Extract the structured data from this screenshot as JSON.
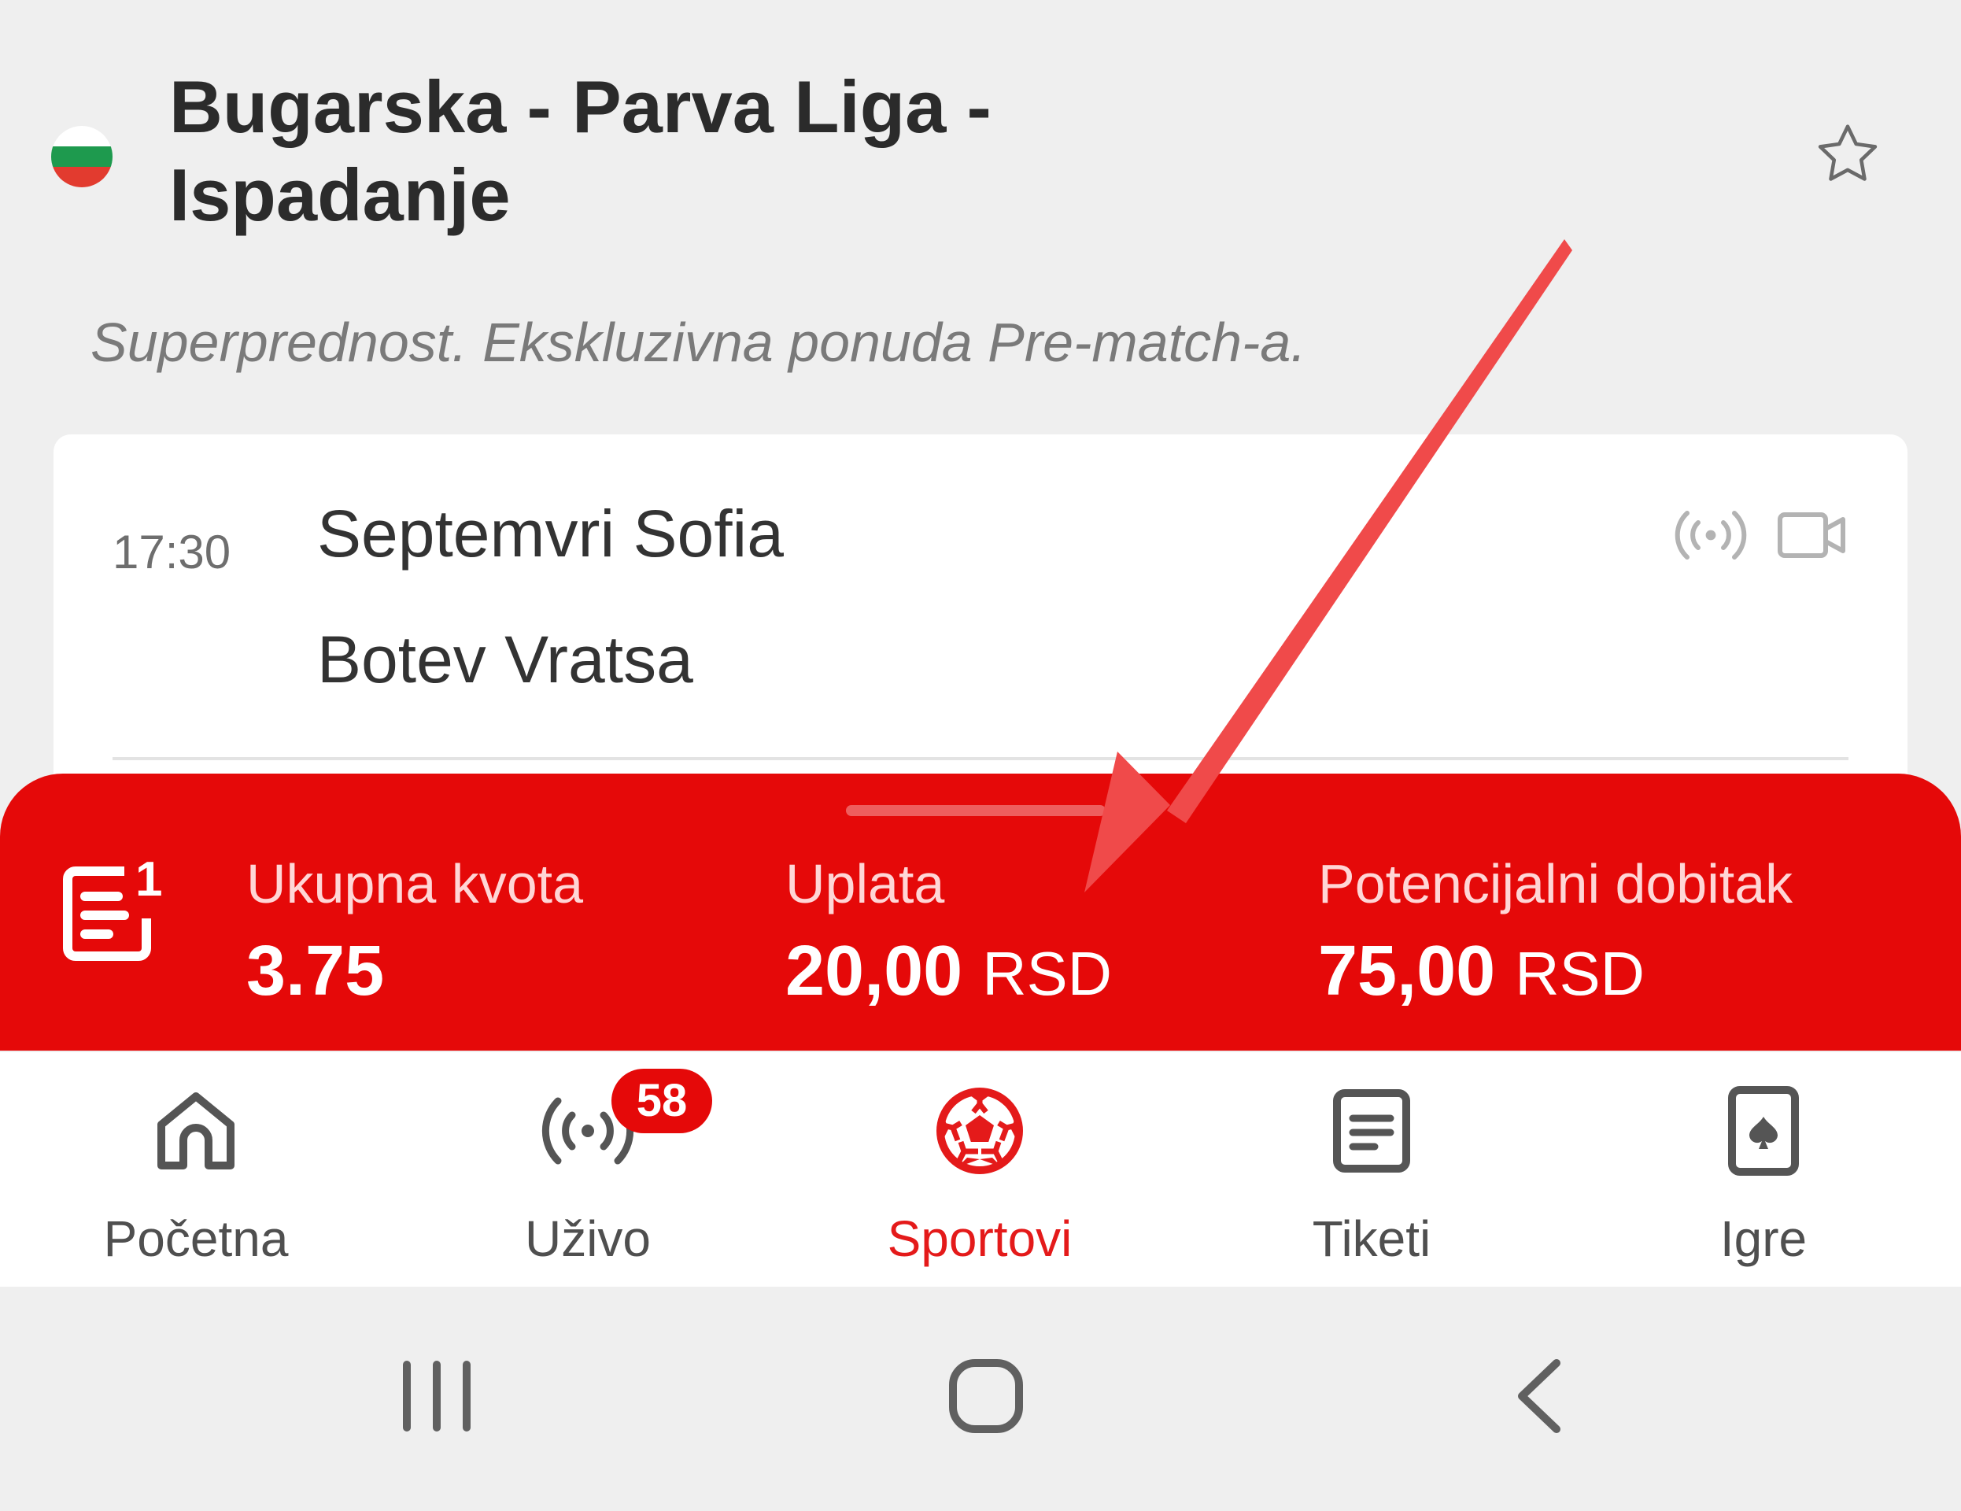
{
  "header": {
    "league_title": "Bugarska - Parva Liga - Ispadanje",
    "subtitle": "Superprednost. Ekskluzivna ponuda Pre-match-a."
  },
  "match": {
    "time": "17:30",
    "home_team": "Septemvri Sofia",
    "away_team": "Botev Vratsa"
  },
  "bet_slip": {
    "ticket_count": "1",
    "total_odds_label": "Ukupna kvota",
    "total_odds_value": "3.75",
    "stake_label": "Uplata",
    "stake_value": "20,00",
    "stake_currency": "RSD",
    "payout_label": "Potencijalni dobitak",
    "payout_value": "75,00",
    "payout_currency": "RSD"
  },
  "nav": {
    "items": [
      {
        "label": "Početna",
        "icon": "home-icon"
      },
      {
        "label": "Uživo",
        "icon": "live-broadcast-icon",
        "badge": "58"
      },
      {
        "label": "Sportovi",
        "icon": "soccer-ball-icon",
        "active": true
      },
      {
        "label": "Tiketi",
        "icon": "ticket-list-icon"
      },
      {
        "label": "Igre",
        "icon": "playing-card-icon"
      }
    ]
  },
  "colors": {
    "accent": "#e50909",
    "background": "#efefef",
    "annotation_arrow": "#f04a4a"
  }
}
